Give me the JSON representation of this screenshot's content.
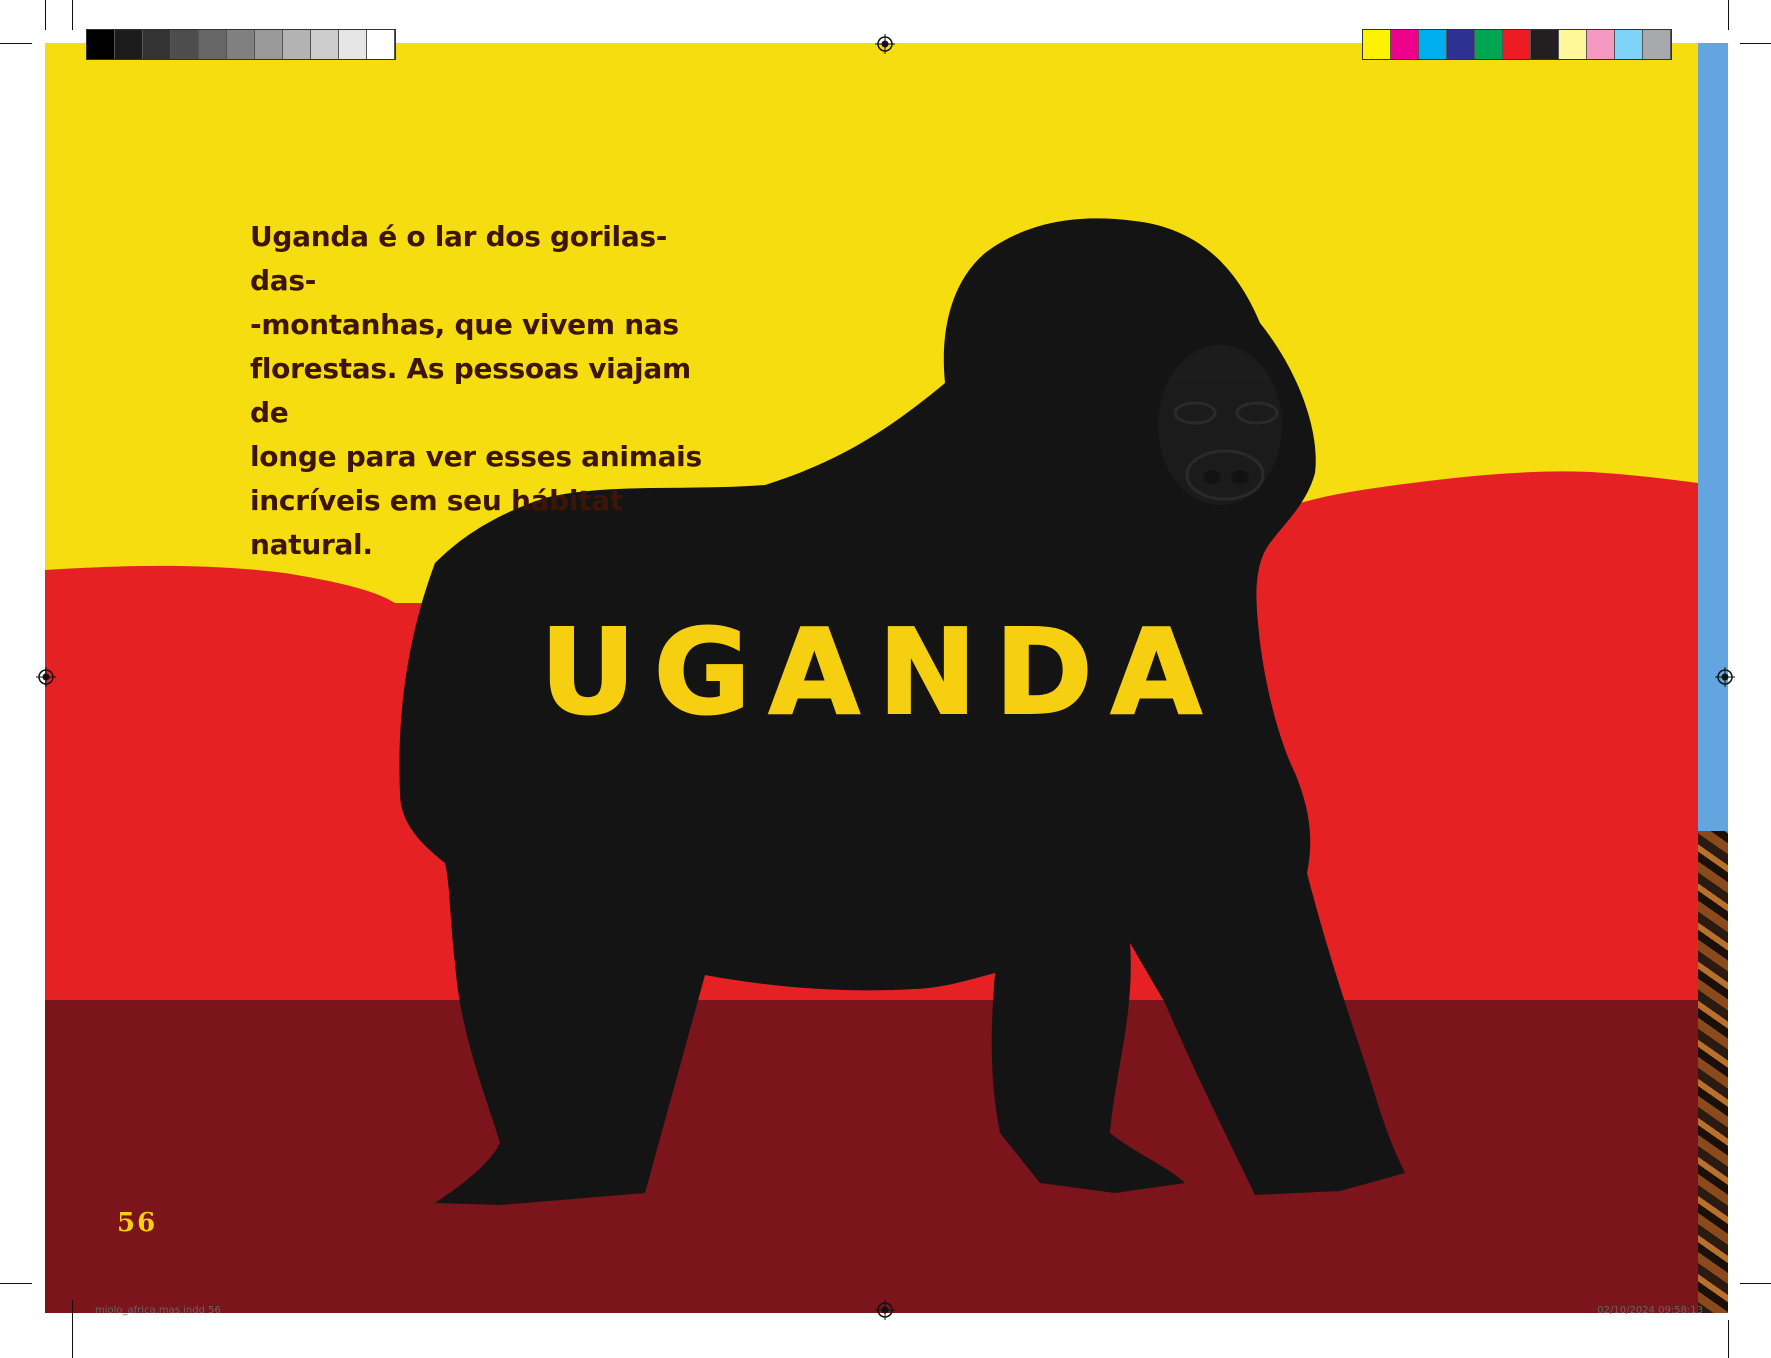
{
  "page": {
    "body_text": "Uganda é o lar dos gorilas-das-\n-montanhas, que vivem nas\nflorestas. As pessoas viajam de\nlonge para ver esses animais\nincríveis em seu hábitat natural.",
    "title": "UGANDA",
    "page_number": "56"
  },
  "colors": {
    "sky": "#f5dd10",
    "hills": "#e52124",
    "ground": "#7c141c",
    "gorilla": "#141414",
    "title": "#f5cf10",
    "text": "#3d1408"
  },
  "print_marks": {
    "slug_left": "miolo_africa.mas.indd 56",
    "slug_right": "02/10/2024 09:58:13",
    "grayscale_swatches": [
      "#000000",
      "#1c1c1c",
      "#333333",
      "#4d4d4d",
      "#666666",
      "#808080",
      "#999999",
      "#b3b3b3",
      "#cccccc",
      "#e6e6e6",
      "#ffffff"
    ],
    "color_swatches": [
      "#fff200",
      "#ec008c",
      "#00aeef",
      "#2e3192",
      "#00a651",
      "#ed1c24",
      "#231f20",
      "#fff799",
      "#f49ac2",
      "#7fd3f7",
      "#a7a9ac"
    ]
  }
}
